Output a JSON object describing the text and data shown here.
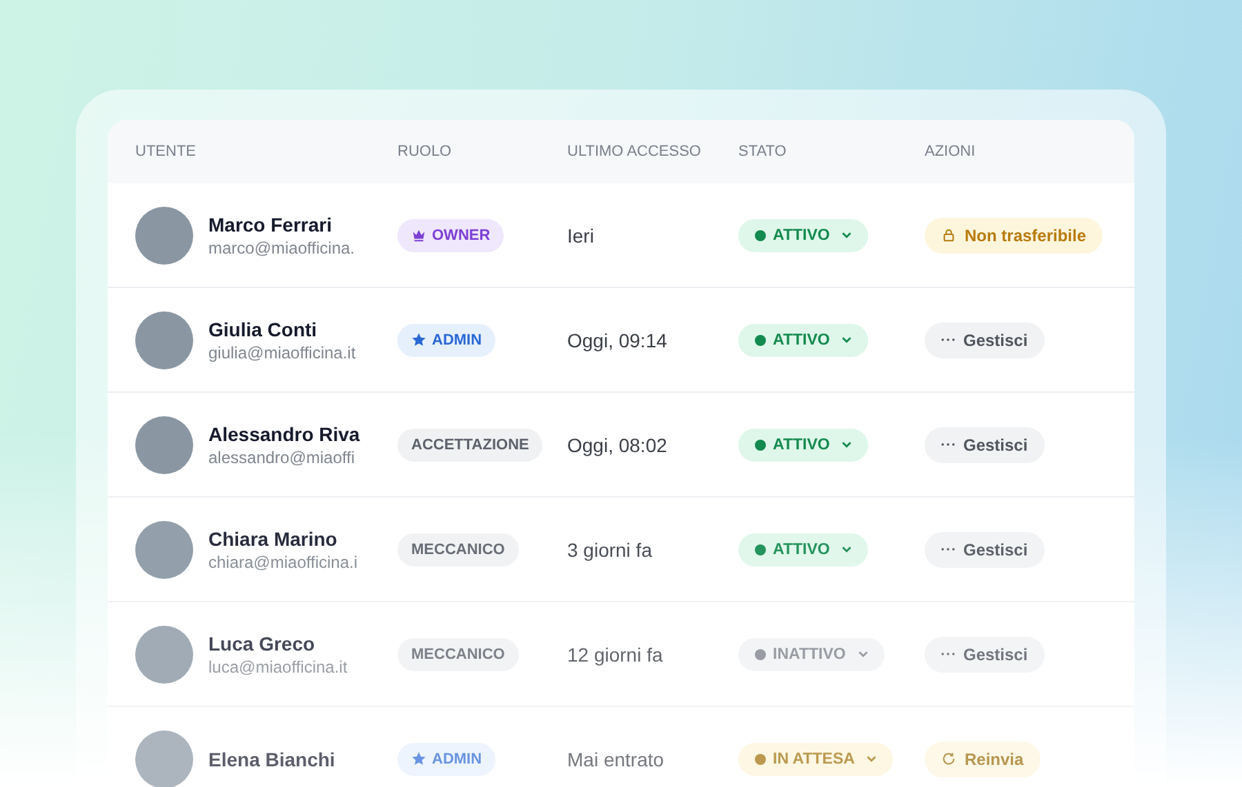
{
  "table": {
    "columns": [
      "UTENTE",
      "RUOLO",
      "ULTIMO ACCESSO",
      "STATO",
      "AZIONI"
    ],
    "rows": [
      {
        "name": "Marco Ferrari",
        "email": "marco@miaofficina.",
        "role": {
          "label": "OWNER",
          "kind": "owner"
        },
        "last_access": "Ieri",
        "status": {
          "label": "ATTIVO",
          "kind": "active"
        },
        "action": {
          "label": "Non trasferibile",
          "kind": "locked"
        }
      },
      {
        "name": "Giulia Conti",
        "email": "giulia@miaofficina.it",
        "role": {
          "label": "ADMIN",
          "kind": "admin"
        },
        "last_access": "Oggi, 09:14",
        "status": {
          "label": "ATTIVO",
          "kind": "active"
        },
        "action": {
          "label": "Gestisci",
          "kind": "manage"
        }
      },
      {
        "name": "Alessandro Riva",
        "email": "alessandro@miaoffi",
        "role": {
          "label": "ACCETTAZIONE",
          "kind": "plain"
        },
        "last_access": "Oggi, 08:02",
        "status": {
          "label": "ATTIVO",
          "kind": "active"
        },
        "action": {
          "label": "Gestisci",
          "kind": "manage"
        }
      },
      {
        "name": "Chiara Marino",
        "email": "chiara@miaofficina.i",
        "role": {
          "label": "MECCANICO",
          "kind": "plain"
        },
        "last_access": "3 giorni fa",
        "status": {
          "label": "ATTIVO",
          "kind": "active"
        },
        "action": {
          "label": "Gestisci",
          "kind": "manage"
        }
      },
      {
        "name": "Luca Greco",
        "email": "luca@miaofficina.it",
        "role": {
          "label": "MECCANICO",
          "kind": "plain"
        },
        "last_access": "12 giorni fa",
        "status": {
          "label": "INATTIVO",
          "kind": "inactive"
        },
        "action": {
          "label": "Gestisci",
          "kind": "manage"
        }
      },
      {
        "name": "Elena Bianchi",
        "role": {
          "label": "ADMIN",
          "kind": "admin"
        },
        "last_access": "Mai entrato",
        "status": {
          "label": "IN ATTESA",
          "kind": "pending"
        },
        "action": {
          "label": "Reinvia",
          "kind": "resend"
        }
      }
    ]
  }
}
